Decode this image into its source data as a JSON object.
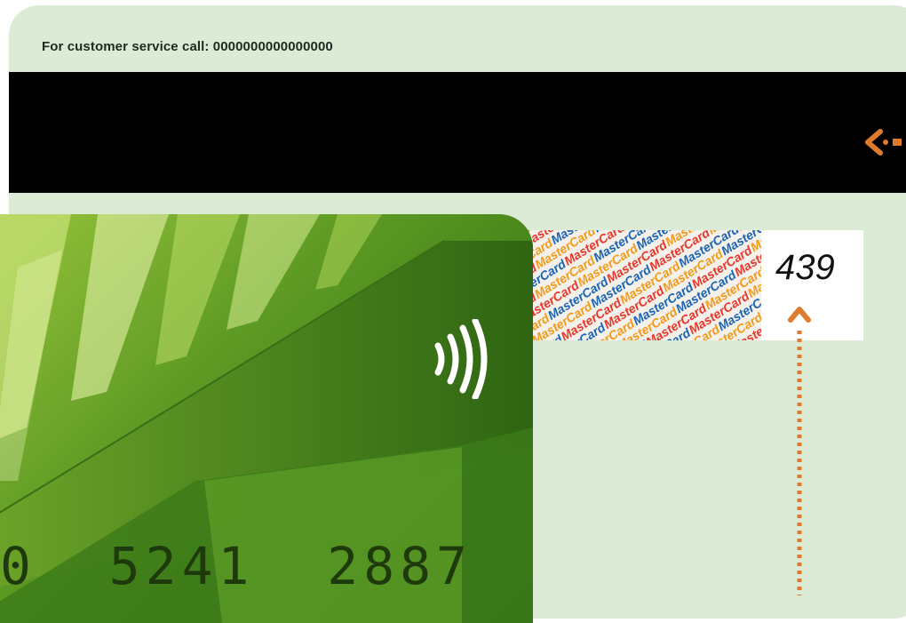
{
  "card_back": {
    "service_label": "For customer service call: 0000000000000000",
    "cvv": "439",
    "signature_pattern_word": "MasterCard",
    "pattern_colors": [
      "#e8372d",
      "#f39a1b",
      "#1b64b5"
    ],
    "arrow_color": "#e07a2c"
  },
  "card_front": {
    "number_partial": "0  5241  2887",
    "contactless_icon": "contactless-icon"
  }
}
